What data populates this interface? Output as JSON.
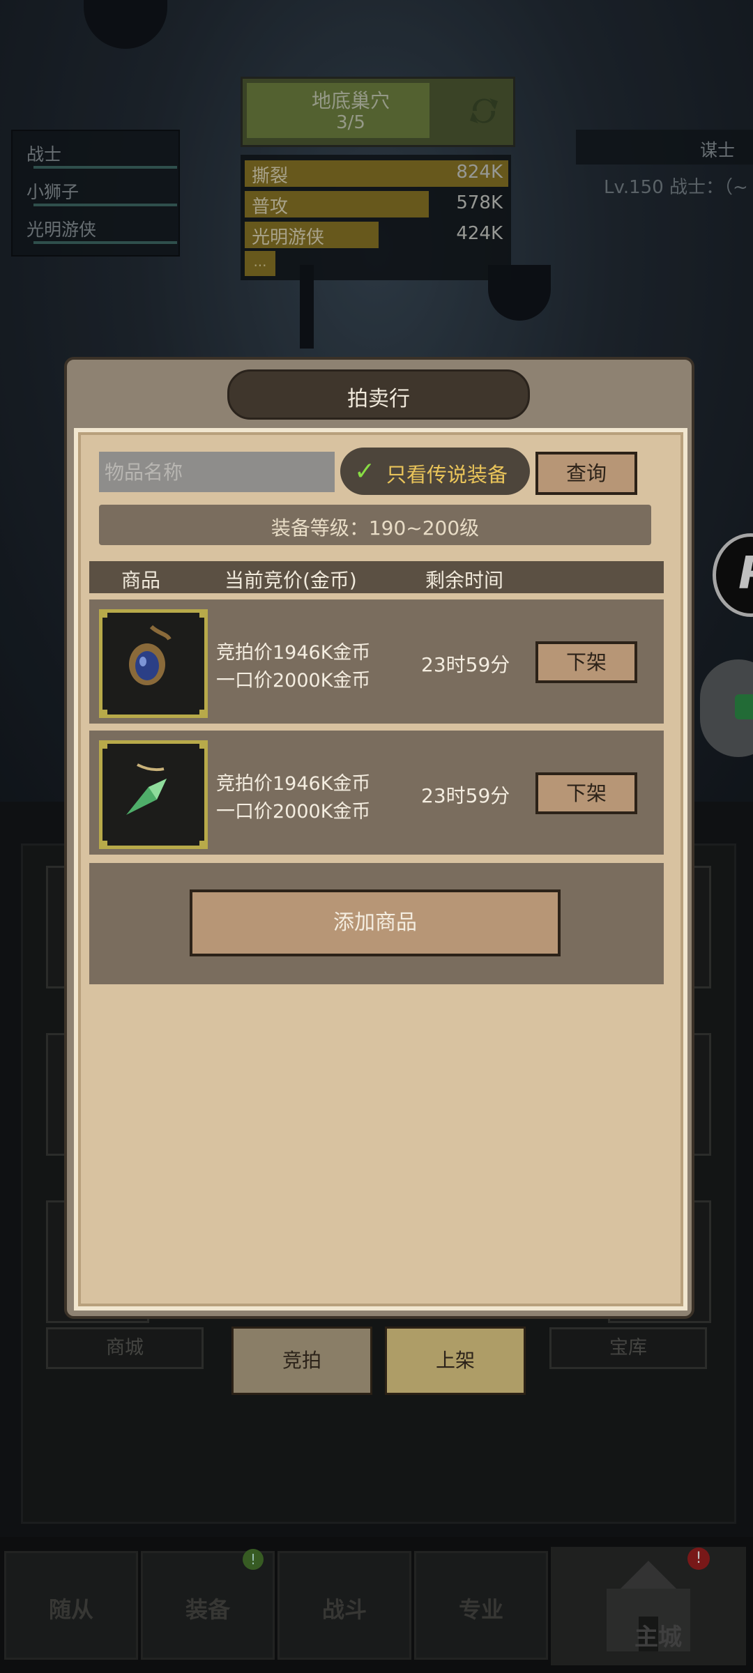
{
  "party": {
    "members": [
      "战士",
      "小狮子",
      "光明游侠"
    ]
  },
  "dungeon": {
    "name": "地底巢穴",
    "progress": "3/5"
  },
  "damage": {
    "rows": [
      {
        "name": "撕裂",
        "value": "824K",
        "fraction": 1.0
      },
      {
        "name": "普攻",
        "value": "578K",
        "fraction": 0.7
      },
      {
        "name": "光明游侠",
        "value": "424K",
        "fraction": 0.51
      }
    ],
    "more": "..."
  },
  "enemy": {
    "name": "谋士",
    "info": "Lv.150 战士：（~"
  },
  "lower_menu": {
    "left_label": "商城",
    "right_label": "宝库"
  },
  "tabs": {
    "auction": "竞拍",
    "list": "上架"
  },
  "bottom_nav": {
    "followers": "随从",
    "equipment": "装备",
    "battle": "战斗",
    "profession": "专业",
    "home": "主城",
    "equipment_badge": "!",
    "home_badge": "!"
  },
  "modal": {
    "title": "拍卖行",
    "search_placeholder": "物品名称",
    "legend_only_label": "只看传说装备",
    "query_label": "查询",
    "level_filter": "装备等级：190~200级",
    "columns": {
      "item": "商品",
      "price": "当前竞价(金币)",
      "time": "剩余时间"
    },
    "listings": [
      {
        "icon": "blue-gem-amulet-icon",
        "bid": "竞拍价1946K金币",
        "buyout": "一口价2000K金币",
        "time_left": "23时59分",
        "action": "下架"
      },
      {
        "icon": "green-crystal-pendant-icon",
        "bid": "竞拍价1946K金币",
        "buyout": "一口价2000K金币",
        "time_left": "23时59分",
        "action": "下架"
      }
    ],
    "add_label": "添加商品"
  },
  "colors": {
    "gold_frame": "#b8aa4a",
    "legend_text": "#e9c45a",
    "check": "#88dd44",
    "paper": "#d8c2a0"
  }
}
